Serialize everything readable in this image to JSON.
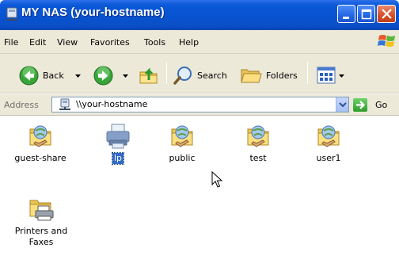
{
  "window": {
    "title": "MY NAS (your-hostname)",
    "icon": "network-drive-icon",
    "controls": [
      "minimize",
      "maximize",
      "close"
    ]
  },
  "menu": {
    "items": [
      "File",
      "Edit",
      "View",
      "Favorites",
      "Tools",
      "Help"
    ]
  },
  "toolbar": {
    "back_label": "Back",
    "search_label": "Search",
    "folders_label": "Folders"
  },
  "address": {
    "label": "Address",
    "value": "\\\\your-hostname",
    "go_label": "Go"
  },
  "items": [
    {
      "label": "guest-share",
      "icon": "shared-folder-icon",
      "selected": false
    },
    {
      "label": "lp",
      "icon": "printer-icon",
      "selected": true
    },
    {
      "label": "public",
      "icon": "shared-folder-icon",
      "selected": false
    },
    {
      "label": "test",
      "icon": "shared-folder-icon",
      "selected": false
    },
    {
      "label": "user1",
      "icon": "shared-folder-icon",
      "selected": false
    },
    {
      "label": "Printers and Faxes",
      "label_line1": "Printers and",
      "label_line2": "Faxes",
      "icon": "printers-folder-icon",
      "selected": false
    }
  ],
  "colors": {
    "titlebar": "#0a58d8",
    "chrome": "#ece9d8",
    "selection": "#316ac5",
    "close_button": "#d6532d"
  }
}
